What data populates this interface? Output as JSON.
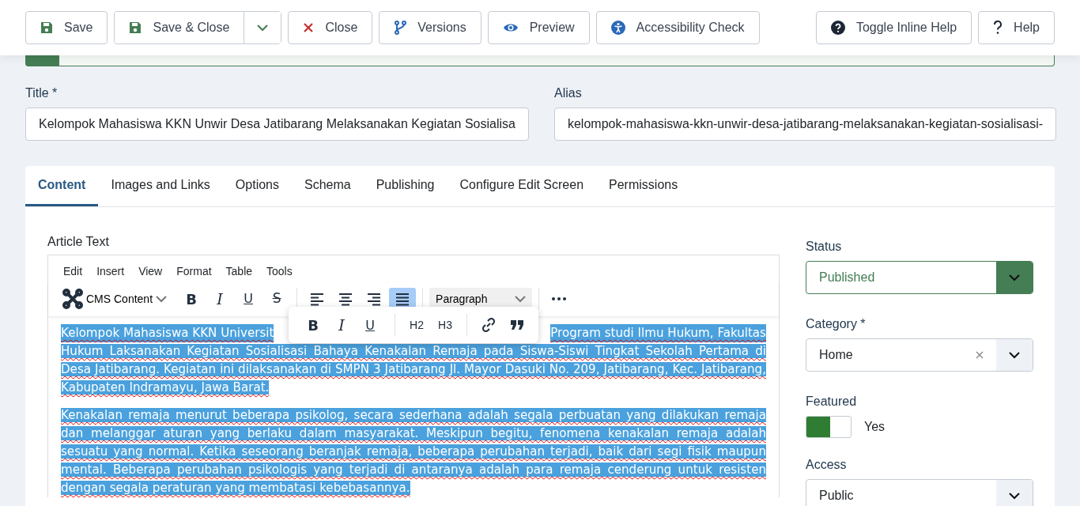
{
  "toolbar": {
    "buttons": [
      {
        "label": "Save",
        "split": false
      },
      {
        "label": "Save & Close",
        "split": true
      },
      {
        "label": "Close",
        "split": false
      },
      {
        "label": "Versions",
        "split": false
      },
      {
        "label": "Preview",
        "split": false
      },
      {
        "label": "Accessibility Check",
        "split": false
      }
    ],
    "help_buttons": [
      {
        "label": "Toggle Inline Help"
      },
      {
        "label": "Help"
      }
    ]
  },
  "form": {
    "title": {
      "label": "Title *",
      "value": "Kelompok Mahasiswa KKN Unwir Desa Jatibarang Melaksanakan Kegiatan Sosialisa"
    },
    "alias": {
      "label": "Alias",
      "value": "kelompok-mahasiswa-kkn-unwir-desa-jatibarang-melaksanakan-kegiatan-sosialisasi-"
    }
  },
  "tabs": [
    {
      "label": "Content",
      "selected": true
    },
    {
      "label": "Images and Links",
      "selected": false
    },
    {
      "label": "Options",
      "selected": false
    },
    {
      "label": "Schema",
      "selected": false
    },
    {
      "label": "Publishing",
      "selected": false
    },
    {
      "label": "Configure Edit Screen",
      "selected": false
    },
    {
      "label": "Permissions",
      "selected": false
    }
  ],
  "editor": {
    "label": "Article Text",
    "menu": [
      "Edit",
      "Insert",
      "View",
      "Format",
      "Table",
      "Tools"
    ],
    "cms_content": "CMS Content",
    "format_tools": [
      {
        "glyph": "B",
        "kind": "bold"
      },
      {
        "glyph": "I",
        "kind": "italic"
      },
      {
        "glyph": "U",
        "kind": "underline"
      },
      {
        "glyph": "S",
        "kind": "strike"
      }
    ],
    "align_tools": [
      {
        "kind": "left",
        "selected": false
      },
      {
        "kind": "center",
        "selected": false
      },
      {
        "kind": "right",
        "selected": false
      },
      {
        "kind": "justify",
        "selected": true
      }
    ],
    "block_format": "Paragraph",
    "popup": {
      "format_tools": [
        {
          "glyph": "B",
          "kind": "bold"
        },
        {
          "glyph": "I",
          "kind": "italic"
        },
        {
          "glyph": "U",
          "kind": "underline"
        }
      ],
      "headings": [
        "H2",
        "H3"
      ]
    },
    "first_line_start": "Kelompok Mahasiswa KKN Universit",
    "first_line_end": "Program studi Ilmu Hukum, Fakultas",
    "paragraphs": [
      {
        "text": "Hukum Laksanakan Kegiatan Sosialisasi Bahaya Kenakalan Remaja pada Siswa-Siswi Tingkat Sekolah Pertama di Desa Jatibarang. Kegiatan ini dilaksanakan di SMPN 3 Jatibarang Jl. Mayor Dasuki No. 209, Jatibarang, Kec. Jatibarang, Kabupaten Indramayu, Jawa Barat.",
        "selected": true
      },
      {
        "text": "Kenakalan remaja menurut beberapa psikolog, secara sederhana adalah segala perbuatan yang dilakukan remaja dan melanggar aturan yang berlaku dalam masyarakat. Meskipun begitu, fenomena kenakalan remaja adalah sesuatu yang normal. Ketika seseorang beranjak remaja, beberapa perubahan terjadi, baik dari segi fisik maupun mental. Beberapa perubahan psikologis yang terjadi di antaranya adalah para remaja cenderung untuk resisten dengan segala peraturan yang membatasi kebebasannya.",
        "selected": true
      }
    ]
  },
  "sidebar": {
    "status": {
      "label": "Status",
      "value": "Published"
    },
    "category": {
      "label": "Category *",
      "value": "Home"
    },
    "featured": {
      "label": "Featured",
      "on": true,
      "text": "Yes"
    },
    "access": {
      "label": "Access",
      "value": "Public"
    }
  }
}
